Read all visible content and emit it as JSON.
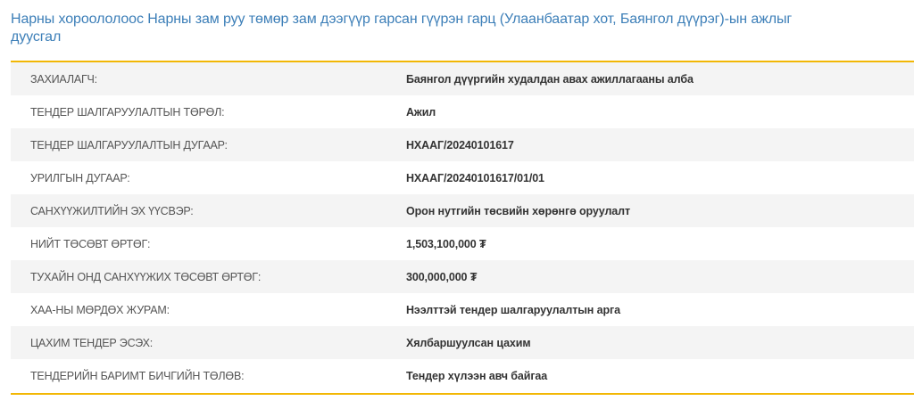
{
  "page_title": "Нарны хороололоос Нарны зам руу төмөр зам дээгүүр гарсан гүүрэн гарц (Улаанбаатар хот, Баянгол дүүрэг)-ын ажлыг дуусгал",
  "rows": [
    {
      "label": "ЗАХИАЛАГЧ:",
      "value": "Баянгол дүүргийн худалдан авах ажиллагааны алба"
    },
    {
      "label": "ТЕНДЕР ШАЛГАРУУЛАЛТЫН ТӨРӨЛ:",
      "value": "Ажил"
    },
    {
      "label": "ТЕНДЕР ШАЛГАРУУЛАЛТЫН ДУГААР:",
      "value": "НХААГ/20240101617"
    },
    {
      "label": "УРИЛГЫН ДУГААР:",
      "value": "НХААГ/20240101617/01/01"
    },
    {
      "label": "САНХҮҮЖИЛТИЙН ЭХ ҮҮСВЭР:",
      "value": "Орон нутгийн төсвийн хөрөнгө оруулалт"
    },
    {
      "label": "НИЙТ ТӨСӨВТ ӨРТӨГ:",
      "value": "1,503,100,000 ₮"
    },
    {
      "label": "ТУХАЙН ОНД САНХҮҮЖИХ ТӨСӨВТ ӨРТӨГ:",
      "value": "300,000,000 ₮"
    },
    {
      "label": "ХАА-НЫ МӨРДӨХ ЖУРАМ:",
      "value": "Нээлттэй тендер шалгаруулалтын арга"
    },
    {
      "label": "ЦАХИМ ТЕНДЕР ЭСЭХ:",
      "value": "Хялбаршуулсан цахим"
    },
    {
      "label": "ТЕНДЕРИЙН БАРИМТ БИЧГИЙН ТӨЛӨВ:",
      "value": "Тендер хүлээн авч байгаа"
    }
  ],
  "colors": {
    "title": "#3d7fb8",
    "accent_rule": "#f2b705",
    "row_alt_bg": "#f4f4f4"
  }
}
